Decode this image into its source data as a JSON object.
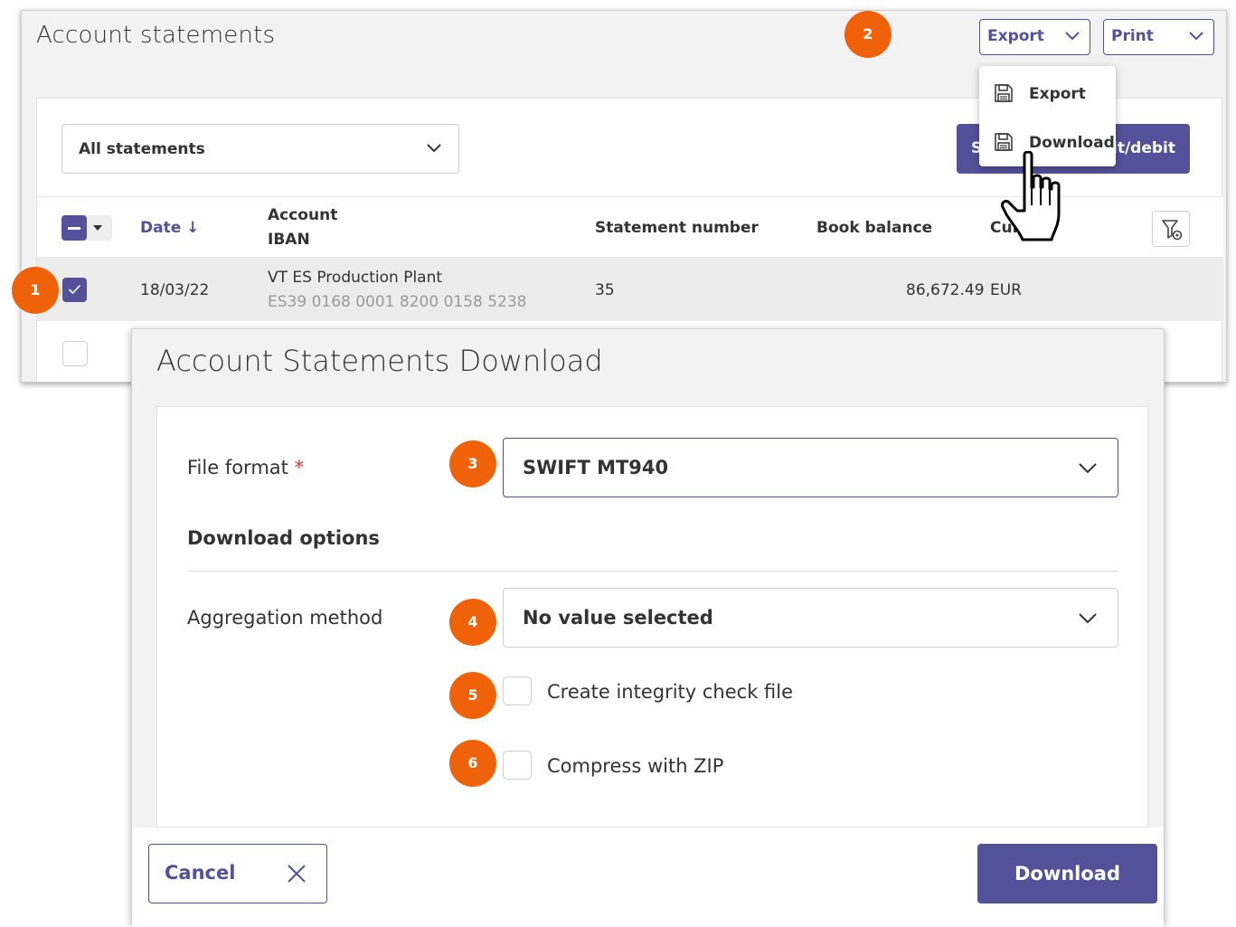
{
  "background_window": {
    "title": "Account statements",
    "export_select": "Export",
    "print_select": "Print",
    "export_menu": [
      {
        "label": "Export",
        "icon": "save-icon"
      },
      {
        "label": "Download",
        "icon": "save-icon"
      }
    ],
    "filter": "All statements",
    "action_button_left": "S",
    "action_button_right": "dit/debit",
    "table": {
      "headers": {
        "date": "Date ↓",
        "account": "Account",
        "iban": "IBAN",
        "statement_number": "Statement number",
        "book_balance": "Book balance",
        "currency": "Curr"
      },
      "rows": [
        {
          "checked": true,
          "date": "18/03/22",
          "account": "VT ES Production Plant",
          "iban": "ES39 0168 0001 8200 0158 5238",
          "statement_number": "35",
          "book_balance": "86,672.49",
          "currency": "EUR"
        }
      ]
    }
  },
  "badges": [
    "1",
    "2",
    "3",
    "4",
    "5",
    "6"
  ],
  "dialog": {
    "title": "Account Statements Download",
    "file_format_label": "File format",
    "required_mark": "*",
    "file_format_value": "SWIFT MT940",
    "section_title": "Download options",
    "aggregation_label": "Aggregation method",
    "aggregation_value": "No value selected",
    "integrity_label": "Create integrity check file",
    "zip_label": "Compress with ZIP",
    "integrity_checked": false,
    "zip_checked": false,
    "cancel_label": "Cancel",
    "download_label": "Download"
  },
  "colors": {
    "accent": "#525199",
    "badge": "#f0620a",
    "required": "#e0303a"
  }
}
